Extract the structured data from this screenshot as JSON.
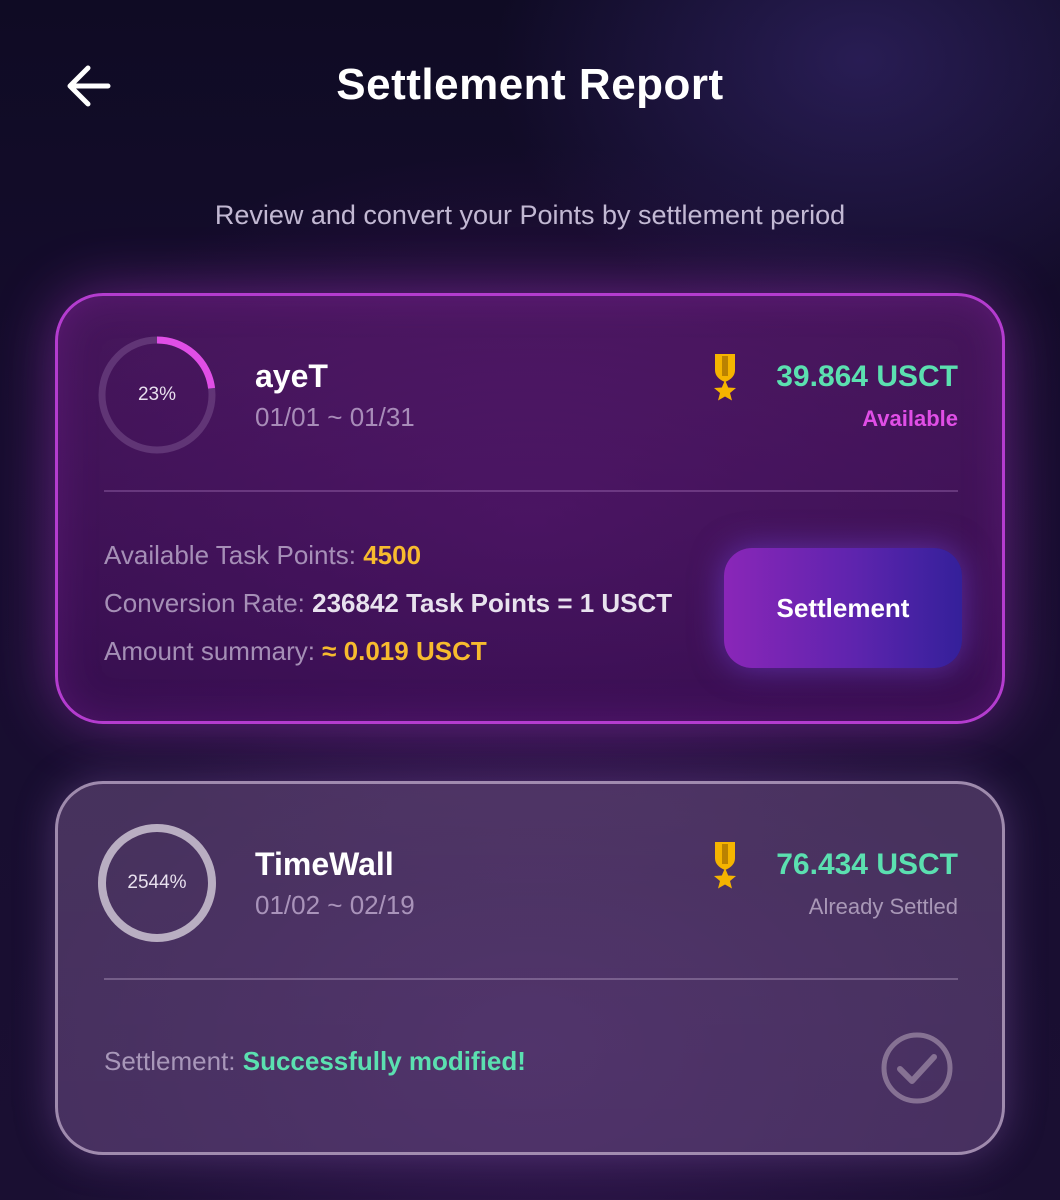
{
  "header": {
    "title": "Settlement Report",
    "back_icon": "arrow-left-icon"
  },
  "subtitle": "Review and convert your Points by settlement period",
  "cards": [
    {
      "progress_label": "23%",
      "progress_fraction": 0.23,
      "name": "ayeT",
      "period": "01/01 ~ 01/31",
      "medal_icon": "medal-icon",
      "amount": "39.864 USCT",
      "status": "Available",
      "available_points_label": "Available Task Points: ",
      "available_points_value": "4500",
      "conversion_rate_label": "Conversion Rate: ",
      "conversion_rate_value": "236842 Task Points = 1 USCT",
      "amount_summary_label": "Amount summary: ",
      "amount_summary_value": "≈ 0.019 USCT",
      "button_label": "Settlement"
    },
    {
      "progress_label": "2544%",
      "progress_fraction": 1,
      "name": "TimeWall",
      "period": "01/02 ~ 02/19",
      "medal_icon": "medal-icon",
      "amount": "76.434 USCT",
      "status": "Already Settled",
      "settlement_label": "Settlement: ",
      "settlement_value": "Successfully modified!",
      "check_icon": "check-circle-icon"
    }
  ],
  "colors": {
    "accent_magenta": "#e04ee6",
    "amount_green": "#5be0b0",
    "highlight_yellow": "#f7bb2e",
    "medal_gold": "#f5b400"
  }
}
